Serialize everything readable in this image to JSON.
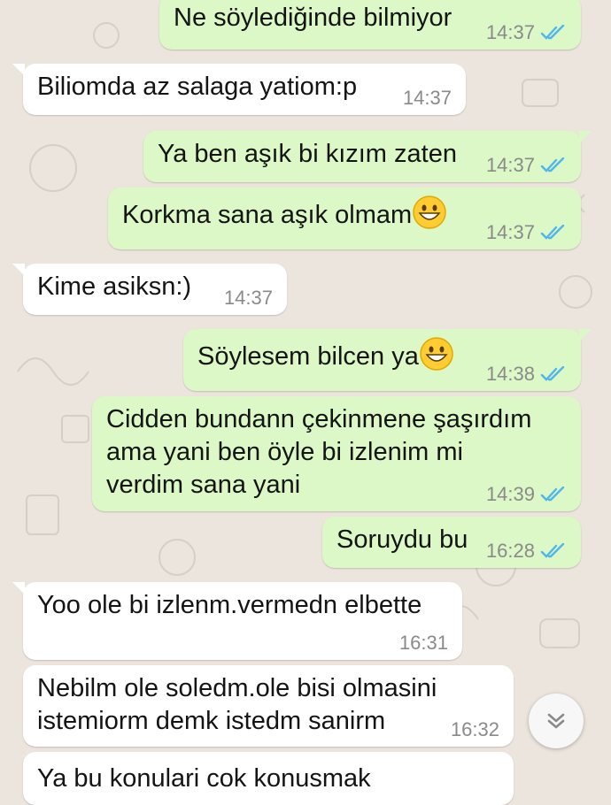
{
  "colors": {
    "outgoing_bubble": "#dcf8c6",
    "incoming_bubble": "#ffffff",
    "background": "#ece5dd",
    "read_ticks": "#4fb6ec"
  },
  "icons": {
    "read_receipt": "double-check-icon",
    "emoji": "grinning-face-icon",
    "scroll": "chevron-double-down-icon"
  },
  "messages": [
    {
      "dir": "out",
      "text": "Ne söylediğinde bilmiyor",
      "time": "14:37",
      "status": "read"
    },
    {
      "dir": "in",
      "text": "Biliomda az salaga yatiom:p",
      "time": "14:37"
    },
    {
      "dir": "out",
      "text": "Ya ben aşık bi kızım zaten",
      "time": "14:37",
      "status": "read"
    },
    {
      "dir": "out",
      "text": "Korkma sana aşık olmam",
      "emoji": "grinning-face",
      "time": "14:37",
      "status": "read"
    },
    {
      "dir": "in",
      "text": "Kime asiksn:)",
      "time": "14:37"
    },
    {
      "dir": "out",
      "text": "Söylesem bilcen ya",
      "emoji": "grinning-face",
      "time": "14:38",
      "status": "read"
    },
    {
      "dir": "out",
      "text": "Cidden bundann çekinmene şaşırdım\nama yani ben öyle bi izlenim mi\nverdim sana yani",
      "time": "14:39",
      "status": "read"
    },
    {
      "dir": "out",
      "text": "Soruydu bu",
      "time": "16:28",
      "status": "read"
    },
    {
      "dir": "in",
      "text": "Yoo ole bi izlenm.vermedn elbette",
      "time": "16:31"
    },
    {
      "dir": "in",
      "text": "Nebilm ole soledm.ole bisi olmasini\nistemiorm demk istedm sanirm",
      "time": "16:32"
    },
    {
      "dir": "in",
      "text": "Ya bu konulari cok konusmak",
      "time": ""
    }
  ]
}
